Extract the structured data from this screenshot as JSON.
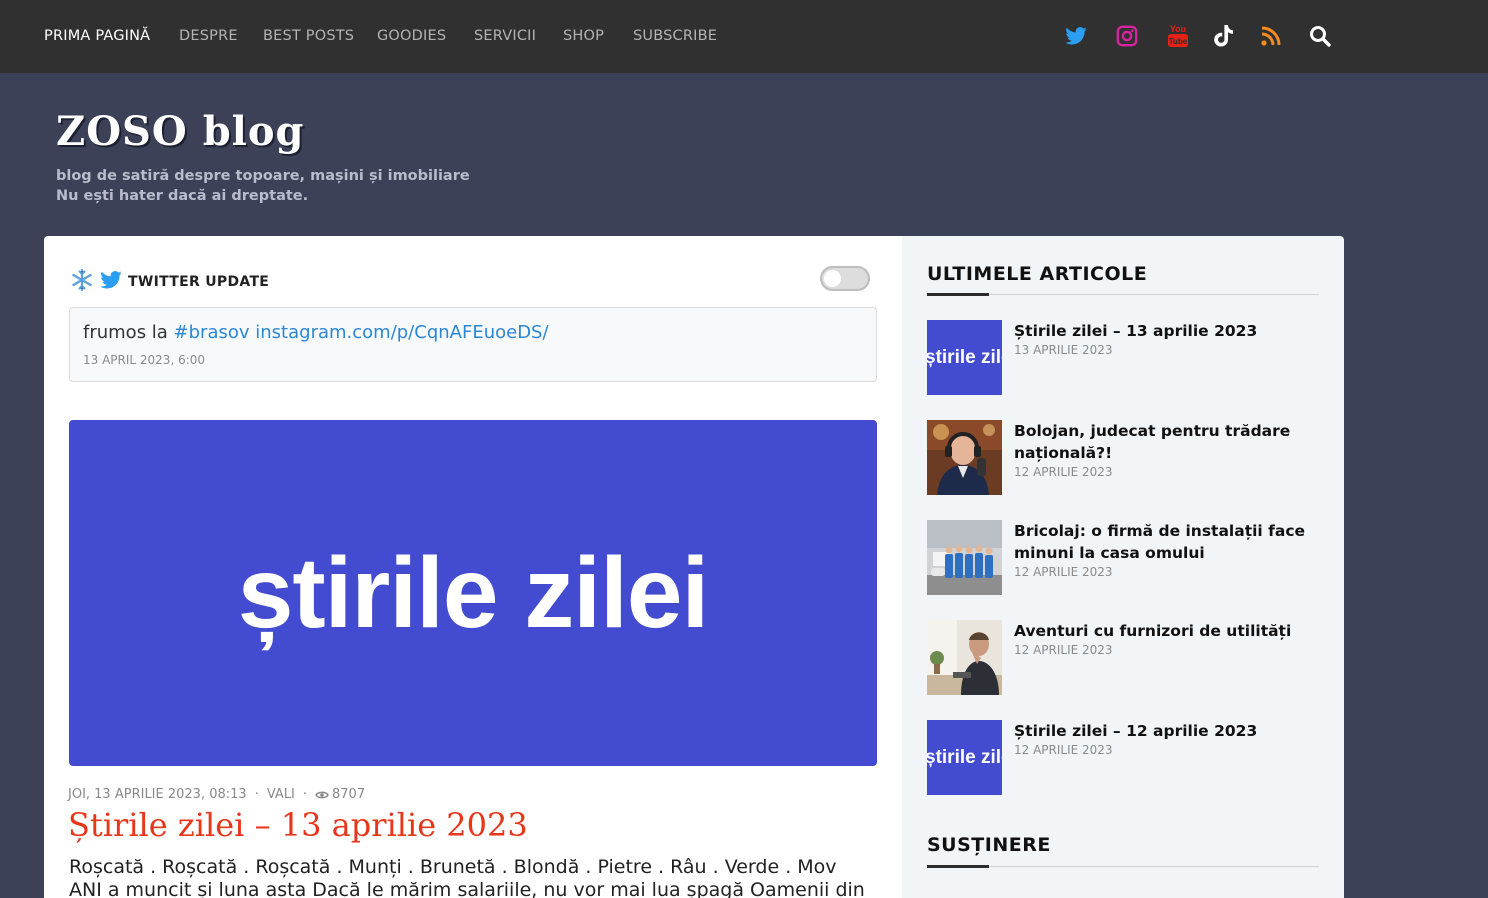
{
  "nav": {
    "items": [
      "PRIMA PAGINĂ",
      "DESPRE",
      "BEST POSTS",
      "GOODIES",
      "SERVICII",
      "SHOP",
      "SUBSCRIBE"
    ],
    "social_icons": [
      "twitter-icon",
      "instagram-icon",
      "youtube-icon",
      "tiktok-icon",
      "rss-icon",
      "search-icon"
    ]
  },
  "header": {
    "logo": "ZOSO blog",
    "tagline1": "blog de satiră despre topoare, mașini și imobiliare",
    "tagline2": "Nu ești hater dacă ai dreptate."
  },
  "twitter": {
    "title": "TWITTER UPDATE",
    "tweet_prefix": "frumos la ",
    "tweet_hashtag": "#brasov",
    "tweet_link": "instagram.com/p/CqnAFEuoeDS/",
    "tweet_date": "13 APRIL 2023, 6:00"
  },
  "post": {
    "hero_text": "știrile zilei",
    "date": "JOI, 13 APRILIE 2023, 08:13",
    "author": "VALI",
    "views": "8707",
    "title": "Știrile zilei – 13 aprilie 2023",
    "excerpt": "Roșcată . Roșcată . Roșcată . Munți . Brunetă . Blondă . Pietre . Râu . Verde . Mov ANI a muncit și luna asta Dacă le mărim salariile, nu vor mai lua șpagă Oamenii din servicii sunt"
  },
  "sidebar": {
    "latest_title": "ULTIMELE ARTICOLE",
    "articles": [
      {
        "title": "Știrile zilei – 13 aprilie 2023",
        "date": "13 APRILIE 2023",
        "thumb_text": "știrile zilei"
      },
      {
        "title": "Bolojan, judecat pentru trădare națională?!",
        "date": "12 APRILIE 2023"
      },
      {
        "title": "Bricolaj: o firmă de instalații face minuni la casa omului",
        "date": "12 APRILIE 2023"
      },
      {
        "title": "Aventuri cu furnizori de utilități",
        "date": "12 APRILIE 2023"
      },
      {
        "title": "Știrile zilei – 12 aprilie 2023",
        "date": "12 APRILIE 2023",
        "thumb_text": "știrile zilei"
      }
    ],
    "support_title": "SUSȚINERE"
  },
  "colors": {
    "nav_bg": "#303030",
    "page_bg": "#3c4158",
    "hero_blue": "#434cd0",
    "title_red": "#e8361a",
    "link_blue": "#2a87d6"
  }
}
